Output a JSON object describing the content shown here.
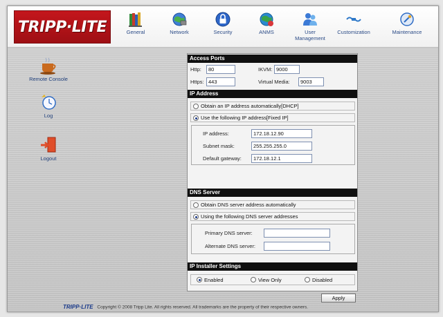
{
  "brand": {
    "logo_text": "TRIPP·LITE",
    "accent": "#c4161c"
  },
  "nav": {
    "items": [
      {
        "label": "General",
        "icon": "books-icon"
      },
      {
        "label": "Network",
        "icon": "network-globe-icon"
      },
      {
        "label": "Security",
        "icon": "lock-icon"
      },
      {
        "label": "ANMS",
        "icon": "anms-globe-icon"
      },
      {
        "label": "User Management",
        "icon": "users-icon"
      },
      {
        "label": "Customization",
        "icon": "plug-icon"
      },
      {
        "label": "Maintenance",
        "icon": "maintenance-icon"
      }
    ]
  },
  "sidebar": {
    "items": [
      {
        "label": "Remote Console",
        "icon": "coffee-cup-icon"
      },
      {
        "label": "Log",
        "icon": "clock-icon"
      },
      {
        "label": "Logout",
        "icon": "logout-door-icon"
      }
    ]
  },
  "access_ports": {
    "title": "Access Ports",
    "http_label": "Http:",
    "http_value": "80",
    "kvm_label": "IKVM:",
    "kvm_value": "9000",
    "https_label": "Https:",
    "https_value": "443",
    "vm_label": "Virtual Media:",
    "vm_value": "9003"
  },
  "ip_address": {
    "title": "IP Address",
    "opt_dhcp": "Obtain an IP address automatically[DHCP]",
    "opt_fixed": "Use the following IP address[Fixed IP]",
    "selected": "fixed",
    "ip_label": "IP address:",
    "ip_value": "172.18.12.90",
    "mask_label": "Subnet mask:",
    "mask_value": "255.255.255.0",
    "gw_label": "Default gateway:",
    "gw_value": "172.18.12.1"
  },
  "dns": {
    "title": "DNS Server",
    "opt_auto": "Obtain DNS server address automatically",
    "opt_manual": "Using the following DNS server addresses",
    "selected": "manual",
    "primary_label": "Primary DNS server:",
    "primary_value": "",
    "alternate_label": "Alternate DNS server:",
    "alternate_value": ""
  },
  "installer": {
    "title": "IP Installer Settings",
    "opt_enabled": "Enabled",
    "opt_view": "View Only",
    "opt_disabled": "Disabled",
    "selected": "enabled"
  },
  "apply_label": "Apply",
  "footer": {
    "logo_text": "TRIPP·LITE",
    "copyright": "Copyright © 2008 Tripp Lite. All rights reserved. All trademarks are the property of their respective owners."
  }
}
